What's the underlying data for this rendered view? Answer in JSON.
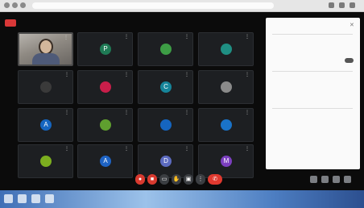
{
  "browser": {
    "url": "",
    "nav_icons": [
      "back-icon",
      "forward-icon",
      "reload-icon"
    ],
    "toolbar_icons": [
      "extensions-icon",
      "profile-icon",
      "menu-icon"
    ]
  },
  "recording_badge": "",
  "participants": [
    {
      "kind": "camera",
      "name": "",
      "initial": "",
      "color": ""
    },
    {
      "kind": "avatar",
      "name": "",
      "initial": "P",
      "color": "#1f7a55"
    },
    {
      "kind": "avatar",
      "name": "",
      "initial": "",
      "color": "#3d9d45"
    },
    {
      "kind": "avatar",
      "name": "",
      "initial": "",
      "color": "#1f8f83"
    },
    {
      "kind": "avatar",
      "name": "",
      "initial": "",
      "color": "#3a3a3a"
    },
    {
      "kind": "avatar",
      "name": "",
      "initial": "",
      "color": "#c81e4a"
    },
    {
      "kind": "avatar",
      "name": "",
      "initial": "C",
      "color": "#16859a"
    },
    {
      "kind": "avatar",
      "name": "",
      "initial": "",
      "color": "#8a8a8a"
    },
    {
      "kind": "avatar",
      "name": "",
      "initial": "A",
      "color": "#1565c0"
    },
    {
      "kind": "avatar",
      "name": "",
      "initial": "",
      "color": "#5f9f2f"
    },
    {
      "kind": "avatar",
      "name": "",
      "initial": "",
      "color": "#1565c0"
    },
    {
      "kind": "avatar",
      "name": "",
      "initial": "",
      "color": "#1a73c8"
    },
    {
      "kind": "avatar",
      "name": "",
      "initial": "",
      "color": "#7cae1f"
    },
    {
      "kind": "avatar",
      "name": "",
      "initial": "A",
      "color": "#1e63c4"
    },
    {
      "kind": "avatar",
      "name": "",
      "initial": "D",
      "color": "#5c6bc0"
    },
    {
      "kind": "avatar",
      "name": "",
      "initial": "M",
      "color": "#7b3fbf"
    }
  ],
  "side_panel": {
    "rows": [
      "",
      "",
      "",
      "",
      "",
      "",
      "",
      "",
      ""
    ],
    "close_icon": "close-icon"
  },
  "bottom_bar": {
    "call_time": "",
    "meeting_code": "",
    "controls": [
      {
        "icon": "mic-off-icon",
        "glyph": "●",
        "style": "red"
      },
      {
        "icon": "camera-off-icon",
        "glyph": "■",
        "style": "red"
      },
      {
        "icon": "captions-icon",
        "glyph": "▭",
        "style": "normal"
      },
      {
        "icon": "raise-hand-icon",
        "glyph": "✋",
        "style": "normal"
      },
      {
        "icon": "present-icon",
        "glyph": "▣",
        "style": "normal"
      },
      {
        "icon": "more-options-icon",
        "glyph": "⋮",
        "style": "normal"
      },
      {
        "icon": "end-call-icon",
        "glyph": "✆",
        "style": "end"
      }
    ],
    "right_icons": [
      "info-icon",
      "people-icon",
      "chat-icon",
      "activities-icon"
    ]
  },
  "taskbar": {
    "icons": [
      "start-icon",
      "search-icon",
      "file-explorer-icon",
      "browser-icon"
    ],
    "clock": ""
  }
}
